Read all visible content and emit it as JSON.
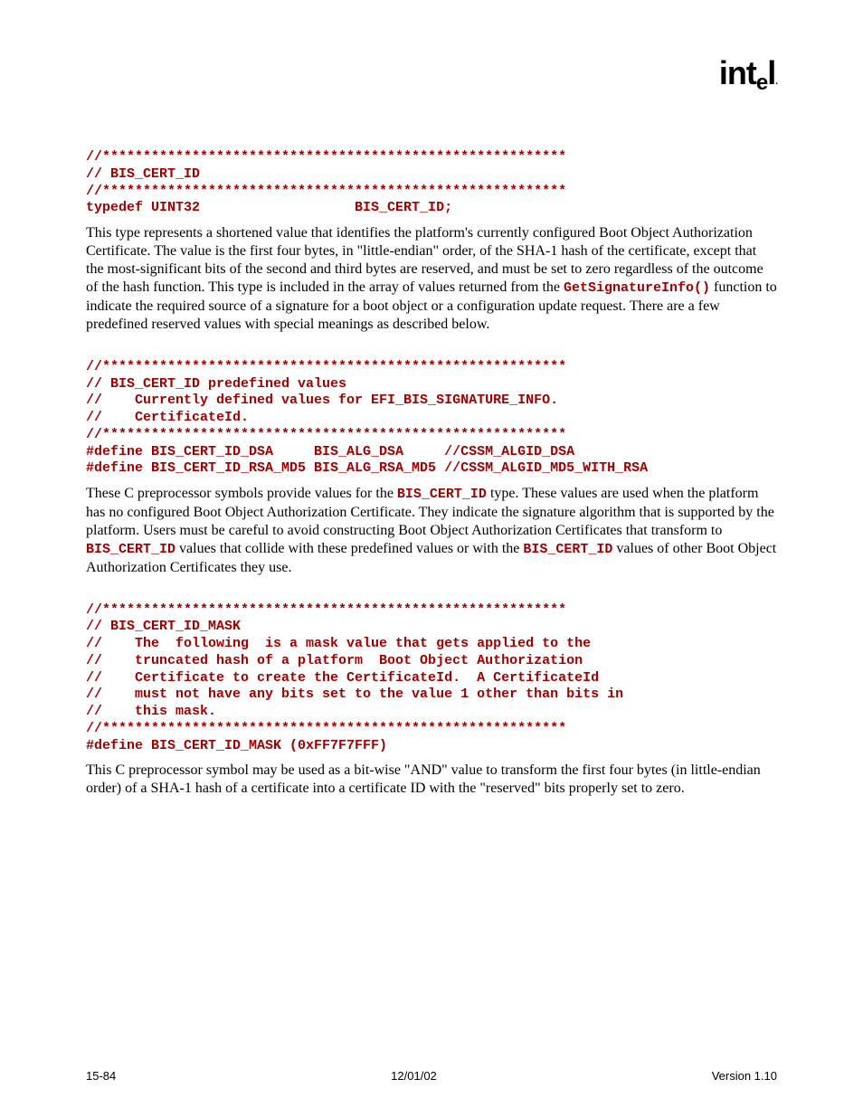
{
  "logo": "intel",
  "code1": "//*********************************************************\n// BIS_CERT_ID\n//*********************************************************\ntypedef UINT32                   BIS_CERT_ID;",
  "para1_a": "This type represents a shortened value that identifies the platform's currently configured Boot Object Authorization Certificate.  The value is the first four bytes, in \"little-endian\" order, of the SHA-1 hash of the certificate, except that the most-significant bits of the second and third bytes are reserved, and must be set to zero regardless of the outcome of the hash function.  This type is included in the array of values returned from the ",
  "para1_mono1": "GetSignatureInfo()",
  "para1_b": " function to indicate the required source of a signature for a boot object or a configuration update request.  There are a few predefined reserved values with special meanings as described below.",
  "code2": "//*********************************************************\n// BIS_CERT_ID predefined values\n//    Currently defined values for EFI_BIS_SIGNATURE_INFO.\n//    CertificateId.\n//*********************************************************\n#define BIS_CERT_ID_DSA     BIS_ALG_DSA     //CSSM_ALGID_DSA\n#define BIS_CERT_ID_RSA_MD5 BIS_ALG_RSA_MD5 //CSSM_ALGID_MD5_WITH_RSA",
  "para2_a": "These C preprocessor symbols provide values for the ",
  "para2_mono1": "BIS_CERT_ID",
  "para2_b": " type.  These values are used when the platform has no configured Boot Object Authorization Certificate.  They indicate the signature algorithm that is supported by the platform.  Users must be careful to avoid constructing Boot Object Authorization Certificates that transform to ",
  "para2_mono2": "BIS_CERT_ID",
  "para2_c": " values that collide with these predefined values or with the ",
  "para2_mono3": "BIS_CERT_ID",
  "para2_d": " values of other Boot Object Authorization Certificates they use.",
  "code3": "//*********************************************************\n// BIS_CERT_ID_MASK\n//    The  following  is a mask value that gets applied to the\n//    truncated hash of a platform  Boot Object Authorization\n//    Certificate to create the CertificateId.  A CertificateId\n//    must not have any bits set to the value 1 other than bits in\n//    this mask.\n//*********************************************************\n#define BIS_CERT_ID_MASK (0xFF7F7FFF)",
  "para3": "This C preprocessor symbol may be used as a bit-wise \"AND\" value to transform the first four bytes (in little-endian order) of a SHA-1 hash of a certificate into a certificate ID with the \"reserved\" bits properly set to zero.",
  "footer_left": "15-84",
  "footer_center": "12/01/02",
  "footer_right": "Version 1.10"
}
